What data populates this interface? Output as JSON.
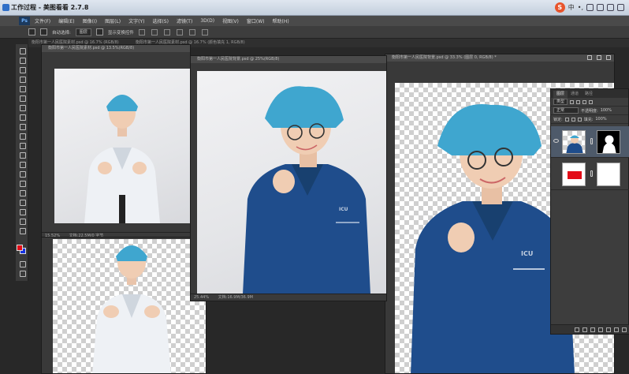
{
  "viewer": {
    "title": "工作过程 - 美图看看 2.7.8",
    "ime": {
      "logo": "S",
      "lang": "中",
      "punct": "•,"
    }
  },
  "menubar": {
    "logo": "Ps",
    "items": [
      "文件(F)",
      "编辑(E)",
      "图像(I)",
      "图层(L)",
      "文字(Y)",
      "选择(S)",
      "滤镜(T)",
      "3D(D)",
      "视图(V)",
      "窗口(W)",
      "帮助(H)"
    ]
  },
  "options": {
    "auto_select_label": "自动选择:",
    "auto_select_value": "图层",
    "transform_label": "显示变换控件"
  },
  "tabs": [
    "衡阳市第一人民医院素材.psd @ 16.7% (RGB/8)",
    "衡阳市第一人民医院素材.psd @ 16.7% (颜色填充 1, RGB/8)"
  ],
  "documents": {
    "left_top": {
      "title": "衡阳市第一人民医院素材.psd @ 13.5%(RGB/8)",
      "zoom": "15.52%",
      "doc_info": "文档:22.5M/0 字节"
    },
    "center": {
      "title": "衡阳市第一人民医院背景.psd @ 25%(RGB/8)",
      "zoom": "25.44%",
      "doc_info": "文档:16.9M/36.9M",
      "badge": "ICU"
    },
    "right": {
      "title": "衡阳市第一人民医院背景.psd @ 33.3% (图层 0, RGB/8) *",
      "zoom": "33.3%",
      "badge": "ICU"
    }
  },
  "layers_panel": {
    "tabs": [
      "图层",
      "通道",
      "路径"
    ],
    "filter_label": "类型",
    "blend_mode": "正常",
    "opacity_label": "不透明度:",
    "opacity_value": "100%",
    "lock_label": "锁定:",
    "fill_label": "填充:",
    "fill_value": "100%"
  },
  "colors": {
    "foreground": "#e30c18",
    "background": "#1632e0",
    "scrub": "#1f4d8c",
    "cap": "#3fa6cf",
    "coat": "#e9edf2"
  }
}
